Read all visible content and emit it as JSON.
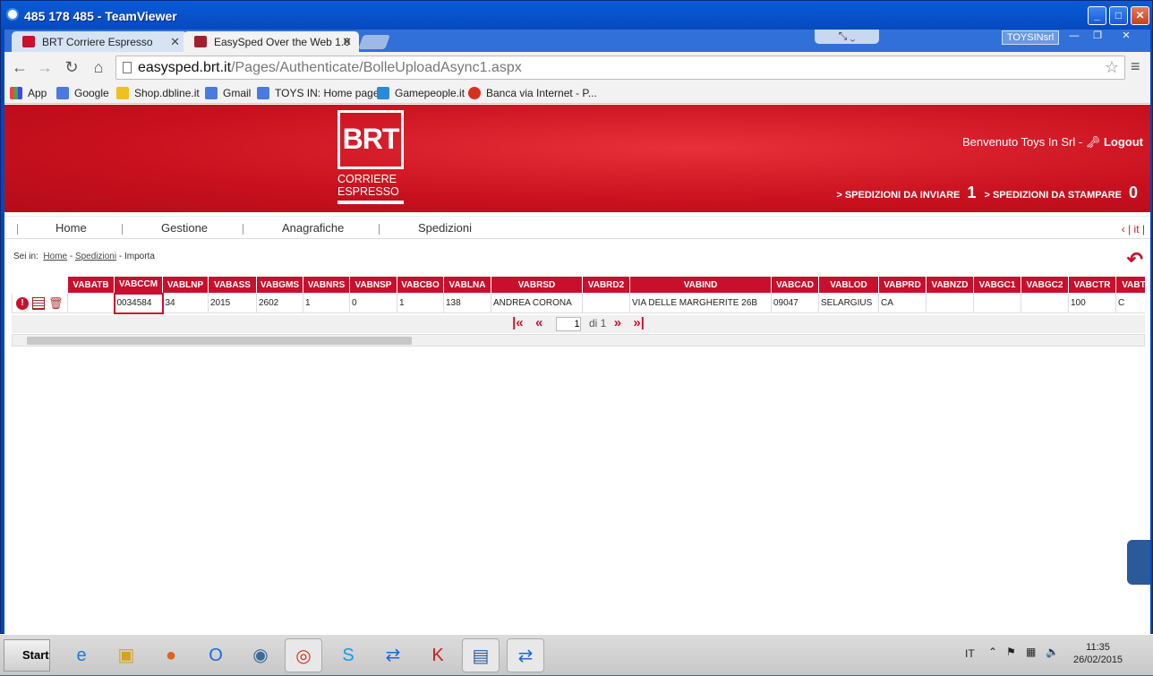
{
  "window": {
    "title": "485 178 485 - TeamViewer"
  },
  "tabs": [
    {
      "label": "BRT Corriere Espresso"
    },
    {
      "label": "EasySped Over the Web 1.0"
    }
  ],
  "user_badge": "TOYSINsrl",
  "address": {
    "host": "easysped.brt.it",
    "path": "/Pages/Authenticate/BolleUploadAsync1.aspx"
  },
  "bookmarks": [
    {
      "label": "App"
    },
    {
      "label": "Google"
    },
    {
      "label": "Shop.dbline.it"
    },
    {
      "label": "Gmail"
    },
    {
      "label": "TOYS IN: Home page"
    },
    {
      "label": "Gamepeople.it"
    },
    {
      "label": "Banca via Internet - P..."
    }
  ],
  "header": {
    "logo_text": "BRT",
    "logo_sub1": "CORRIERE",
    "logo_sub2": "ESPRESSO",
    "welcome": "Benvenuto Toys In Srl -",
    "logout": "Logout",
    "to_send_label": "SPEDIZIONI DA INVIARE",
    "to_send_count": "1",
    "to_print_label": "SPEDIZIONI DA STAMPARE",
    "to_print_count": "0"
  },
  "menu": [
    "Home",
    "Gestione",
    "Anagrafiche",
    "Spedizioni"
  ],
  "lang": "it",
  "breadcrumb": {
    "prefix": "Sei in:",
    "home": "Home",
    "spedizioni": "Spedizioni",
    "current": "Importa"
  },
  "table": {
    "columns": [
      "VABATB",
      "VABCCM",
      "VABLNP",
      "VABASS",
      "VABGMS",
      "VABNRS",
      "VABNSP",
      "VABCBO",
      "VABLNA",
      "VABRSD",
      "VABRD2",
      "VABIND",
      "VABCAD",
      "VABLOD",
      "VABPRD",
      "VABNZD",
      "VABGC1",
      "VABGC2",
      "VABCTR",
      "VABT"
    ],
    "rows": [
      [
        "",
        "0034584",
        "34",
        "2015",
        "2602",
        "1",
        "0",
        "1",
        "138",
        "ANDREA CORONA",
        "",
        "VIA DELLE MARGHERITE 26B",
        "09047",
        "SELARGIUS",
        "CA",
        "",
        "",
        "",
        "100",
        "C"
      ]
    ]
  },
  "pager": {
    "page": "1",
    "of": "di 1"
  },
  "taskbar": {
    "start": "Start",
    "lang": "IT",
    "time": "11:35",
    "date": "26/02/2015"
  }
}
